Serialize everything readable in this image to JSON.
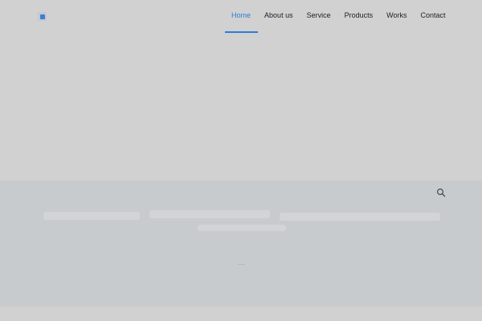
{
  "logo": {
    "icon": "logo-icon"
  },
  "nav": {
    "items": [
      {
        "label": "Home",
        "active": true
      },
      {
        "label": "About us",
        "active": false
      },
      {
        "label": "Service",
        "active": false
      },
      {
        "label": "Products",
        "active": false
      },
      {
        "label": "Works",
        "active": false
      },
      {
        "label": "Contact",
        "active": false
      }
    ]
  },
  "search": {
    "icon": "search-icon"
  },
  "colors": {
    "accent": "#2c7cd6",
    "background": "#d1d1d1",
    "band": "#c8cbcd",
    "nav_text": "#1e1e1e"
  }
}
